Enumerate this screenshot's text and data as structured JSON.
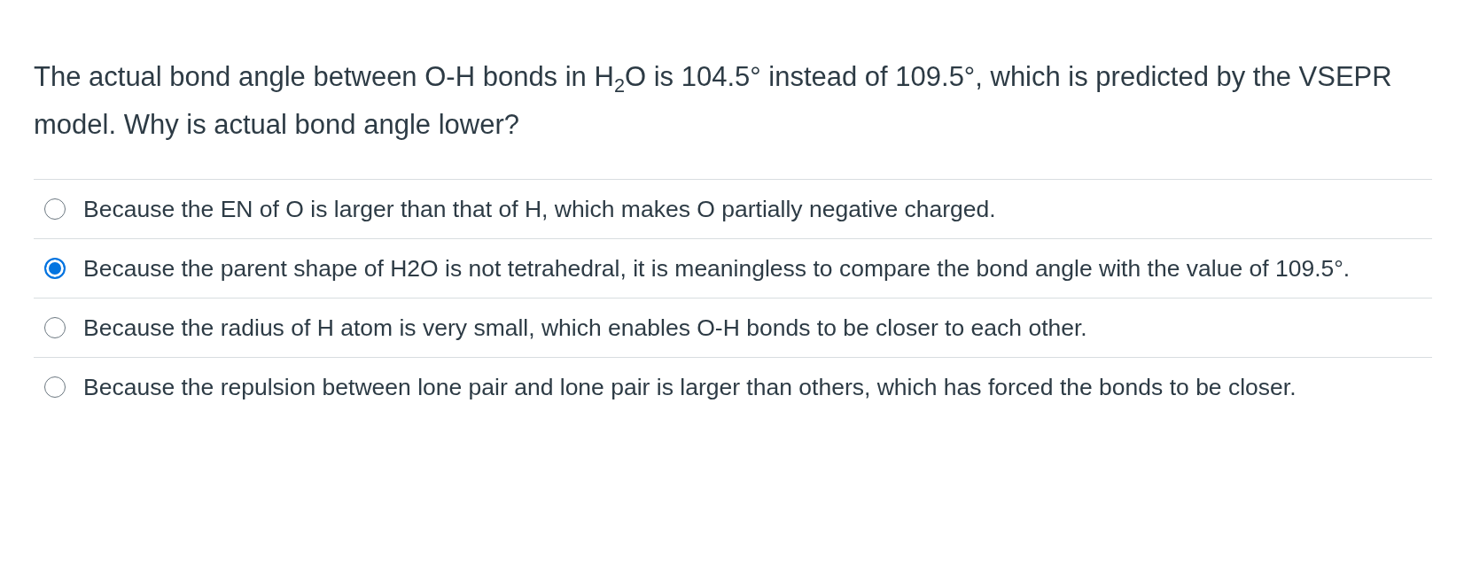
{
  "question": "The actual bond angle between O-H bonds in H$_{2}$O is 104.5° instead of 109.5°, which is predicted by the VSEPR model. Why is actual bond angle lower?",
  "options": [
    {
      "label": "Because the EN of O is larger than that of H, which makes O partially negative charged.",
      "selected": false
    },
    {
      "label": "Because the parent shape of H2O is not tetrahedral, it is meaningless to compare the bond angle with the value of 109.5°.",
      "selected": true
    },
    {
      "label": "Because the radius of H atom is very small, which enables O-H bonds to be closer to each other.",
      "selected": false
    },
    {
      "label": "Because the repulsion between lone pair and lone pair is larger than others, which has forced the bonds to be closer.",
      "selected": false
    }
  ]
}
